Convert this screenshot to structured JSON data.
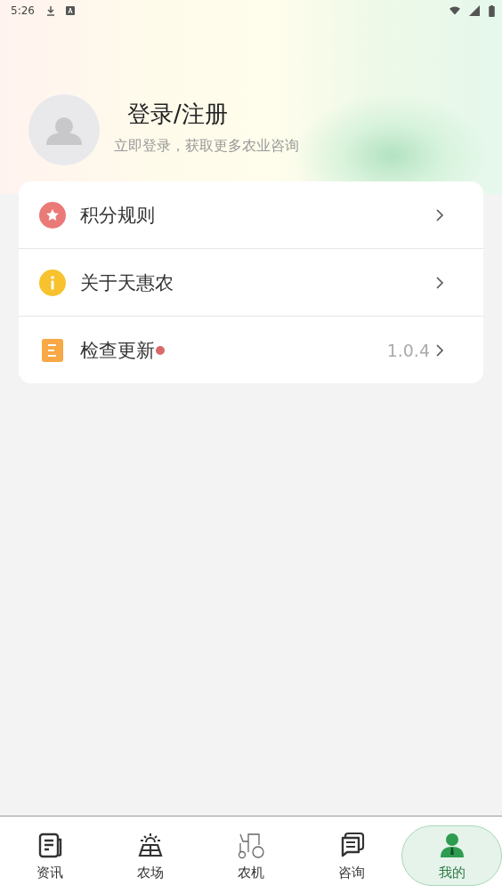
{
  "status_bar": {
    "time": "5:26"
  },
  "profile": {
    "title": "登录/注册",
    "subtitle": "立即登录，获取更多农业咨询"
  },
  "menu": [
    {
      "kind": "star",
      "label": "积分规则",
      "badge": false
    },
    {
      "kind": "info",
      "label": "关于天惠农",
      "badge": false
    },
    {
      "kind": "update",
      "label": "检查更新",
      "badge": true,
      "value": "1.0.4"
    }
  ],
  "tabs": [
    {
      "kind": "news",
      "label": "资讯",
      "selected": false
    },
    {
      "kind": "farm",
      "label": "农场",
      "selected": false
    },
    {
      "kind": "machine",
      "label": "农机",
      "selected": false
    },
    {
      "kind": "consult",
      "label": "咨询",
      "selected": false
    },
    {
      "kind": "me",
      "label": "我的",
      "selected": true
    }
  ]
}
